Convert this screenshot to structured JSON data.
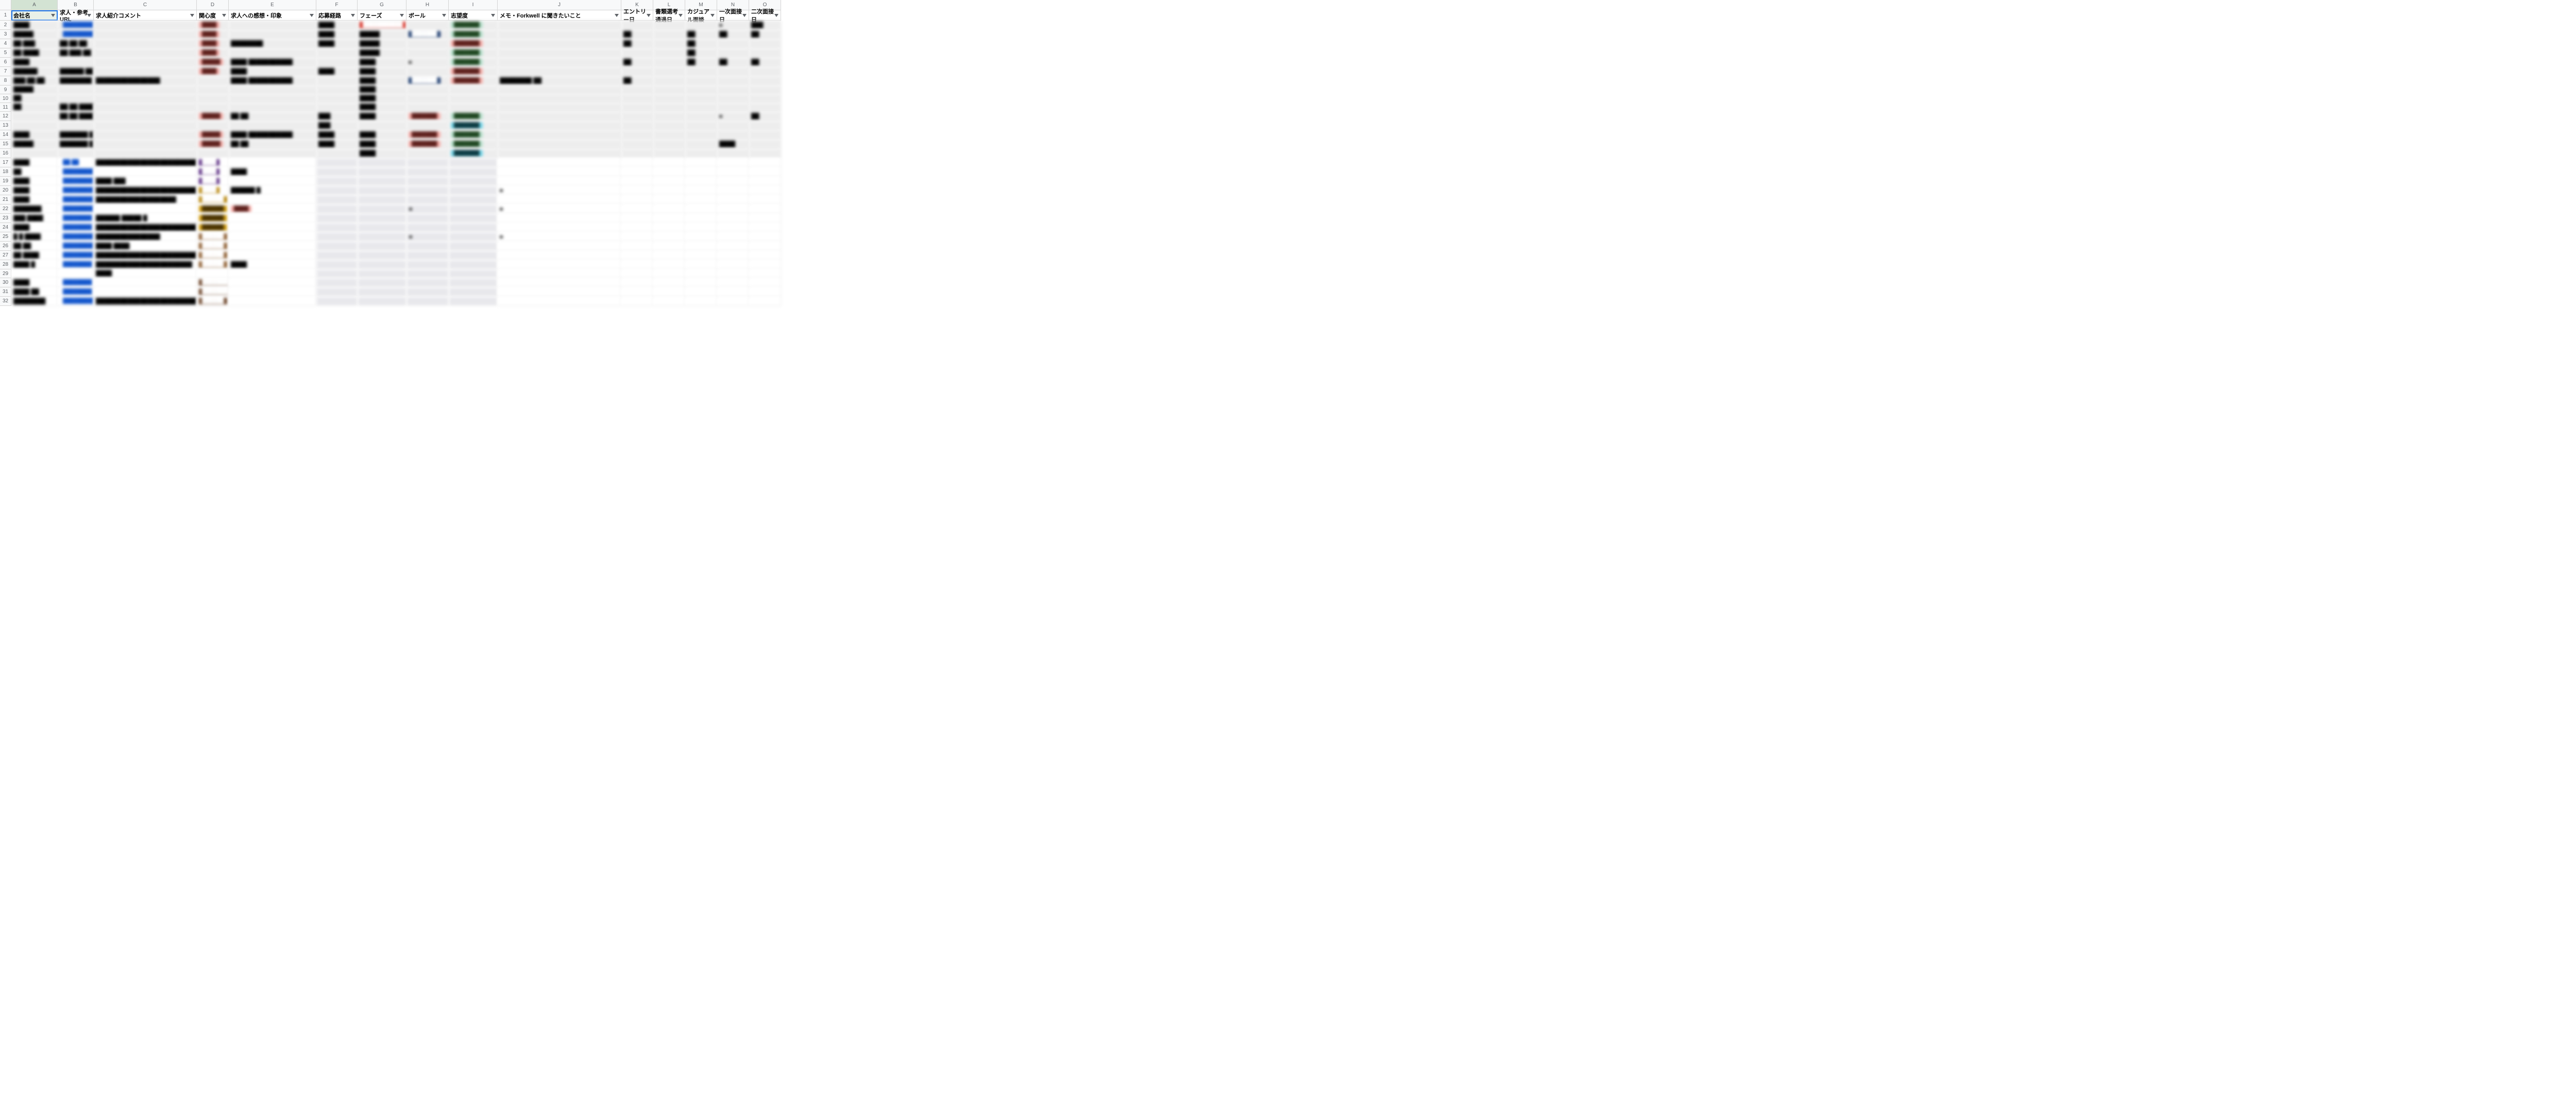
{
  "cols": [
    "",
    "A",
    "B",
    "C",
    "D",
    "E",
    "F",
    "G",
    "H",
    "I",
    "J",
    "K",
    "L",
    "M",
    "N",
    "O"
  ],
  "headers": [
    "会社名",
    "求人・参考URL",
    "求人紹介コメント",
    "関心度",
    "求人への感想・印象",
    "応募経路",
    "フェーズ",
    "ボール",
    "志望度",
    "メモ・Forkwell に聞きたいこと",
    "エントリー日",
    "書類選考通過日",
    "カジュアル面談",
    "一次面接日",
    "二次面接日"
  ],
  "rows": [
    {
      "n": 2,
      "h": "",
      "shade": true,
      "a": "████",
      "b": "████████████",
      "bcls": "c-blue",
      "c": "",
      "d": "████",
      "dcls": "c-pink",
      "e": "",
      "f": "████",
      "g": "███████████",
      "gcls": "c-red",
      "i": "███████",
      "icls": "c-green",
      "j": "",
      "k": "",
      "l": "",
      "m": "",
      "n2": "■",
      "o": "███"
    },
    {
      "n": 3,
      "h": "███████",
      "shade": true,
      "a": "█████",
      "b": "████████████",
      "bcls": "c-blue",
      "c": "",
      "d": "████",
      "dcls": "c-pink",
      "e": "",
      "f": "████",
      "g": "█████",
      "hcls": "c-navy",
      "i": "███████",
      "icls": "c-green",
      "j": "",
      "k": "██",
      "l": "",
      "m": "██",
      "n2": "██",
      "o": "██"
    },
    {
      "n": 4,
      "h": "",
      "shade": true,
      "a": "██ ███",
      "b": "██ ██ ██",
      "c": "",
      "d": "████",
      "dcls": "c-pink",
      "e": "████████",
      "f": "████",
      "g": "█████",
      "i": "███████",
      "icls": "c-pink",
      "j": "",
      "k": "██",
      "l": "",
      "m": "██",
      "n2": "",
      "o": ""
    },
    {
      "n": 5,
      "h": "",
      "shade": true,
      "a": "██ ████",
      "b": "██ ███ ██",
      "c": "",
      "d": "████",
      "dcls": "c-pink",
      "e": "",
      "f": "",
      "g": "█████",
      "i": "███████",
      "icls": "c-green",
      "j": "",
      "k": "",
      "l": "",
      "m": "██",
      "n2": "",
      "o": ""
    },
    {
      "n": 6,
      "h": "■",
      "shade": true,
      "a": "████",
      "b": "",
      "c": "",
      "d": "█████",
      "dcls": "c-pink",
      "e": "████ ███████████",
      "f": "",
      "g": "████",
      "i": "███████",
      "icls": "c-green",
      "j": "",
      "k": "██",
      "l": "",
      "m": "██",
      "n2": "██",
      "o": "██"
    },
    {
      "n": 7,
      "h": "",
      "shade": true,
      "a": "██████",
      "b": "██████ ███ █",
      "c": "",
      "d": "████",
      "dcls": "c-pink",
      "e": "████",
      "f": "████",
      "g": "████",
      "i": "███████",
      "icls": "c-pink",
      "j": "",
      "k": "",
      "l": "",
      "m": "",
      "n2": "",
      "o": ""
    },
    {
      "n": 8,
      "h": "███████",
      "shade": true,
      "a": "███ ██ ██",
      "b": "████████",
      "c": "████████████████",
      "d": "",
      "e": "████ ███████████",
      "f": "",
      "g": "████",
      "hcls": "c-navy",
      "i": "███████",
      "icls": "c-pink",
      "j": "████████ ██",
      "k": "██",
      "l": "",
      "m": "",
      "n2": "",
      "o": ""
    },
    {
      "n": 9,
      "h": "",
      "shade": true,
      "a": "█████",
      "b": "",
      "c": "",
      "d": "",
      "e": "",
      "f": "",
      "g": "████",
      "i": "",
      "j": "",
      "k": "",
      "l": "",
      "m": "",
      "n2": "",
      "o": ""
    },
    {
      "n": 10,
      "h": "",
      "shade": true,
      "a": "██",
      "b": "",
      "c": "",
      "d": "",
      "e": "",
      "f": "",
      "g": "████",
      "i": "",
      "j": "",
      "k": "",
      "l": "",
      "m": "",
      "n2": "",
      "o": ""
    },
    {
      "n": 11,
      "h": "",
      "shade": true,
      "a": "██",
      "b": "██ ██ ████████",
      "c": "",
      "d": "",
      "e": "",
      "f": "",
      "g": "████",
      "i": "",
      "j": "",
      "k": "",
      "l": "",
      "m": "",
      "n2": "",
      "o": ""
    },
    {
      "n": 12,
      "h": "███████",
      "shade": true,
      "a": "",
      "b": "██ ██ ████████",
      "c": "",
      "d": "█████",
      "dcls": "c-pink",
      "e": "██ ██",
      "f": "███",
      "g": "████",
      "hcls": "c-pink",
      "i": "███████",
      "icls": "c-green",
      "j": "",
      "k": "",
      "l": "",
      "m": "",
      "n2": "■",
      "o": "██"
    },
    {
      "n": 13,
      "h": "",
      "shade": true,
      "a": "",
      "b": "",
      "c": "",
      "d": "",
      "e": "",
      "f": "███",
      "g": "",
      "i": "███████",
      "icls": "c-teal",
      "j": "",
      "k": "",
      "l": "",
      "m": "",
      "n2": "",
      "o": ""
    },
    {
      "n": 14,
      "h": "███████",
      "shade": true,
      "a": "████",
      "b": "███████ ████████",
      "c": "",
      "d": "█████",
      "dcls": "c-pink",
      "e": "████ ███████████",
      "f": "████",
      "g": "████",
      "hcls": "c-pink",
      "i": "███████",
      "icls": "c-green",
      "j": "",
      "k": "",
      "l": "",
      "m": "",
      "n2": "",
      "o": ""
    },
    {
      "n": 15,
      "h": "███████",
      "shade": true,
      "a": "█████",
      "b": "███████ ████████",
      "c": "",
      "d": "█████",
      "dcls": "c-pink",
      "e": "██ ██",
      "f": "████",
      "g": "████",
      "hcls": "c-pink",
      "i": "███████",
      "icls": "c-green",
      "j": "",
      "k": "",
      "l": "",
      "m": "",
      "n2": "████",
      "o": ""
    },
    {
      "n": 16,
      "h": "",
      "shade": true,
      "a": "",
      "b": "",
      "c": "",
      "d": "",
      "e": "",
      "f": "",
      "g": "████",
      "i": "███████",
      "icls": "c-teal",
      "j": "",
      "k": "",
      "l": "",
      "m": "",
      "n2": "",
      "o": ""
    },
    {
      "n": 17,
      "h": "",
      "a": "████",
      "b": "██ ██",
      "bcls": "c-blue",
      "c": "████████████████████████████████████████████████████████",
      "d": "████",
      "dcls": "c-purple",
      "e": "",
      "f": "",
      "g": "",
      "i": "",
      "j": "",
      "k": "",
      "l": "",
      "m": "",
      "n2": "",
      "o": ""
    },
    {
      "n": 18,
      "h": "",
      "a": "██",
      "b": "████████████",
      "bcls": "c-blue",
      "c": "",
      "d": "████",
      "dcls": "c-purple",
      "e": "████",
      "f": "",
      "g": "",
      "i": "",
      "j": "",
      "k": "",
      "l": "",
      "m": "",
      "n2": "",
      "o": ""
    },
    {
      "n": 19,
      "h": "",
      "a": "████",
      "b": "████████████",
      "bcls": "c-blue",
      "c": "████ ███",
      "d": "████",
      "dcls": "c-purple",
      "e": "",
      "f": "",
      "g": "",
      "i": "",
      "j": "",
      "k": "",
      "l": "",
      "m": "",
      "n2": "",
      "o": ""
    },
    {
      "n": 20,
      "h": "",
      "a": "████",
      "b": "████████████",
      "bcls": "c-blue",
      "c": "██████████████████████████████",
      "d": "████",
      "dcls": "c-gold",
      "e": "██████ █",
      "f": "",
      "g": "",
      "i": "",
      "j": "■",
      "k": "",
      "l": "",
      "m": "",
      "n2": "",
      "o": ""
    },
    {
      "n": 21,
      "h": "",
      "a": "████",
      "b": "████████████",
      "bcls": "c-blue",
      "c": "████████████████████",
      "d": "██████",
      "dcls": "c-gold",
      "e": "",
      "f": "",
      "g": "",
      "i": "",
      "j": "",
      "k": "",
      "l": "",
      "m": "",
      "n2": "",
      "o": ""
    },
    {
      "n": 22,
      "h": "■",
      "a": "███████",
      "b": "████████████",
      "bcls": "c-blue",
      "c": "",
      "d": "██████",
      "dcls": "c-ochre",
      "e": "████",
      "ecls": "c-pink",
      "f": "",
      "g": "",
      "i": "",
      "j": "■",
      "k": "",
      "l": "",
      "m": "",
      "n2": "",
      "o": ""
    },
    {
      "n": 23,
      "h": "",
      "a": "███ ████",
      "b": "████████",
      "bcls": "c-blue",
      "c": "██████ █████ █",
      "d": "██████",
      "dcls": "c-ochre",
      "e": "",
      "f": "",
      "g": "",
      "i": "",
      "j": "",
      "k": "",
      "l": "",
      "m": "",
      "n2": "",
      "o": ""
    },
    {
      "n": 24,
      "h": "",
      "a": "████",
      "b": "████████",
      "bcls": "c-blue",
      "c": "██████████████████████████████████████████████",
      "d": "██████",
      "dcls": "c-ochre",
      "e": "",
      "f": "",
      "g": "",
      "i": "",
      "j": "",
      "k": "",
      "l": "",
      "m": "",
      "n2": "",
      "o": ""
    },
    {
      "n": 25,
      "h": "■",
      "a": "█ █ ████",
      "b": "████████████",
      "bcls": "c-blue",
      "c": "████████████████",
      "d": "██████",
      "dcls": "c-brown",
      "e": "",
      "f": "",
      "g": "",
      "i": "",
      "j": "■",
      "k": "",
      "l": "",
      "m": "",
      "n2": "",
      "o": ""
    },
    {
      "n": 26,
      "h": "",
      "a": "██ ██",
      "b": "████████████",
      "bcls": "c-blue",
      "c": "████ ████",
      "d": "██████",
      "dcls": "c-brown",
      "e": "",
      "f": "",
      "g": "",
      "i": "",
      "j": "",
      "k": "",
      "l": "",
      "m": "",
      "n2": "",
      "o": ""
    },
    {
      "n": 27,
      "h": "",
      "a": "██ ████",
      "b": "████████████",
      "bcls": "c-blue",
      "c": "████████████████████████████ █",
      "d": "██████",
      "dcls": "c-brown",
      "e": "",
      "f": "",
      "g": "",
      "i": "",
      "j": "",
      "k": "",
      "l": "",
      "m": "",
      "n2": "",
      "o": ""
    },
    {
      "n": 28,
      "h": "",
      "a": "████ █",
      "b": "████████",
      "bcls": "c-blue",
      "c": "████████████████████████",
      "d": "██████",
      "dcls": "c-brown",
      "e": "████",
      "f": "",
      "g": "",
      "i": "",
      "j": "",
      "k": "",
      "l": "",
      "m": "",
      "n2": "",
      "o": ""
    },
    {
      "n": 29,
      "h": "",
      "a": "",
      "b": "",
      "c": "████",
      "d": "",
      "e": "",
      "f": "",
      "g": "",
      "i": "",
      "j": "",
      "k": "",
      "l": "",
      "m": "",
      "n2": "",
      "o": ""
    },
    {
      "n": 30,
      "h": "",
      "a": "████",
      "b": "████████",
      "bcls": "c-blue",
      "c": "",
      "d": "████████",
      "dcls": "c-dbrown",
      "e": "",
      "f": "",
      "g": "",
      "i": "",
      "j": "",
      "k": "",
      "l": "",
      "m": "",
      "n2": "",
      "o": ""
    },
    {
      "n": 31,
      "h": "",
      "a": "████ ██",
      "b": "████████",
      "bcls": "c-blue",
      "c": "",
      "d": "████████",
      "dcls": "c-dbrown",
      "e": "",
      "f": "",
      "g": "",
      "i": "",
      "j": "",
      "k": "",
      "l": "",
      "m": "",
      "n2": "",
      "o": ""
    },
    {
      "n": 32,
      "h": "",
      "a": "████████",
      "b": "████████████",
      "bcls": "c-blue",
      "c": "████████████████████████████",
      "d": "██████",
      "dcls": "c-dbrown",
      "e": "",
      "f": "",
      "g": "",
      "i": "",
      "j": "",
      "k": "",
      "l": "",
      "m": "",
      "n2": "",
      "o": ""
    }
  ]
}
